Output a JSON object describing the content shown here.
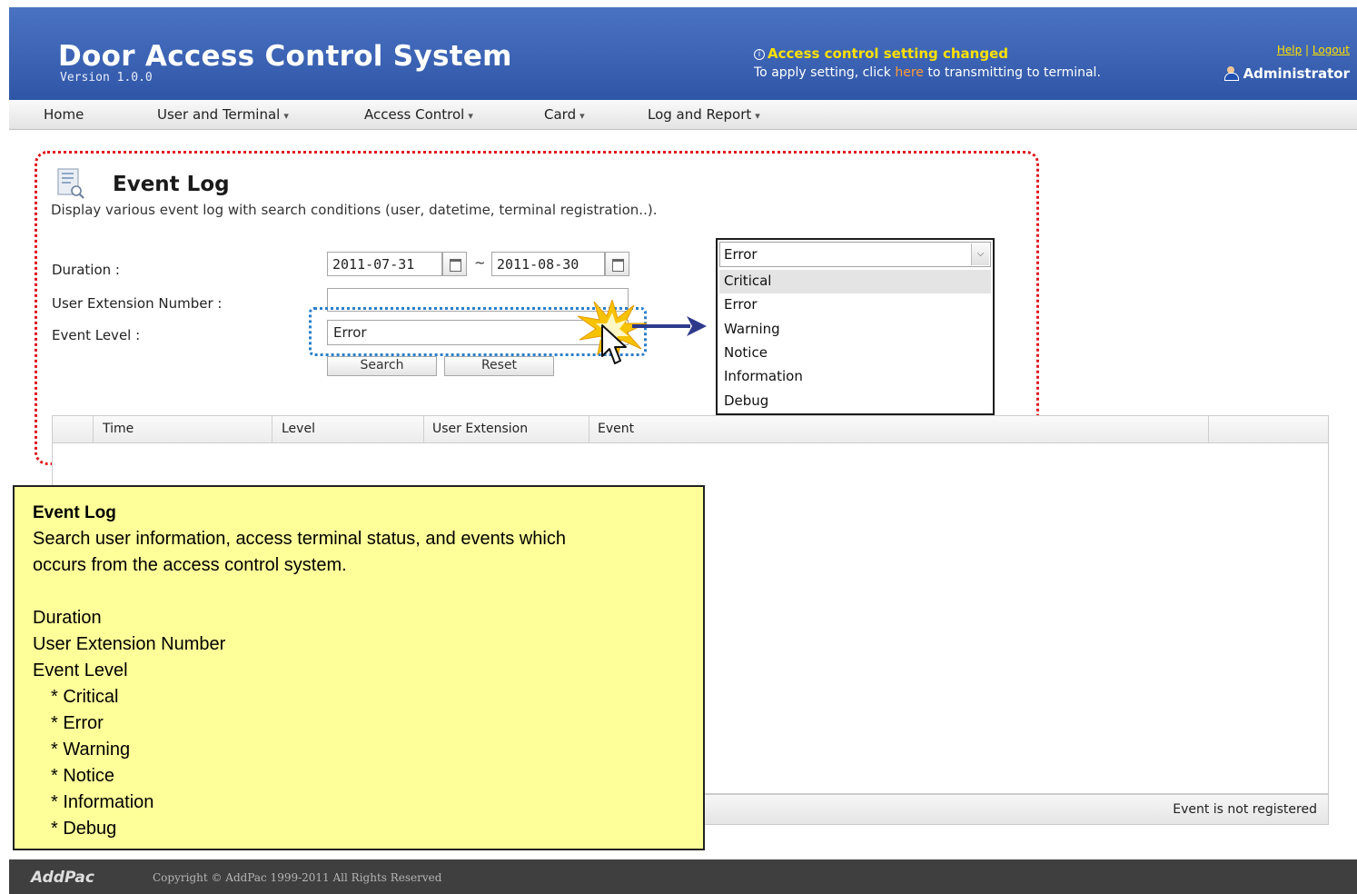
{
  "header": {
    "title": "Door Access Control System",
    "version": "Version 1.0.0",
    "notice_title": "Access control setting changed",
    "notice_prefix": "To apply setting, click ",
    "notice_link": "here",
    "notice_suffix": " to transmitting to terminal.",
    "help_label": "Help",
    "separator": " | ",
    "logout_label": "Logout",
    "user_name": "Administrator"
  },
  "nav": {
    "items": [
      {
        "label": "Home"
      },
      {
        "label": "User and Terminal"
      },
      {
        "label": "Access Control"
      },
      {
        "label": "Card"
      },
      {
        "label": "Log and Report"
      }
    ],
    "caret": "▾"
  },
  "page": {
    "title": "Event Log",
    "description": "Display various event log with search conditions (user, datetime, terminal registration..)."
  },
  "form": {
    "duration_label": "Duration :",
    "extension_label": "User Extension Number :",
    "level_label": "Event Level :",
    "date_from": "2011-07-31",
    "date_sep": "~",
    "date_to": "2011-08-30",
    "extension_value": "",
    "level_value": "Error",
    "search_label": "Search",
    "reset_label": "Reset"
  },
  "dropdown": {
    "selected": "Error",
    "options": [
      "Critical",
      "Error",
      "Warning",
      "Notice",
      "Information",
      "Debug"
    ],
    "highlighted": "Critical"
  },
  "table": {
    "columns": [
      "Time",
      "Level",
      "User Extension",
      "Event"
    ],
    "rows": [],
    "status": "Event is not registered"
  },
  "callout": {
    "title": "Event Log",
    "line1": "Search user information, access terminal status, and events which",
    "line2": "occurs from the access control system.",
    "items": [
      "Duration",
      "User Extension Number",
      "Event Level"
    ],
    "levels": [
      "* Critical",
      "* Error",
      "* Warning",
      "* Notice",
      "* Information",
      "* Debug"
    ]
  },
  "footer": {
    "logo": "AddPac",
    "copyright": "Copyright © AddPac 1999-2011 All Rights Reserved"
  },
  "colors": {
    "header_blue": "#3c63b4",
    "notice_yellow": "#ffe100",
    "link_orange": "#ff9b3a",
    "highlight_red": "#e0151e",
    "highlight_blue": "#2b7fc9",
    "callout_bg": "#ffff99",
    "footer_bg": "#3f3f3f"
  }
}
